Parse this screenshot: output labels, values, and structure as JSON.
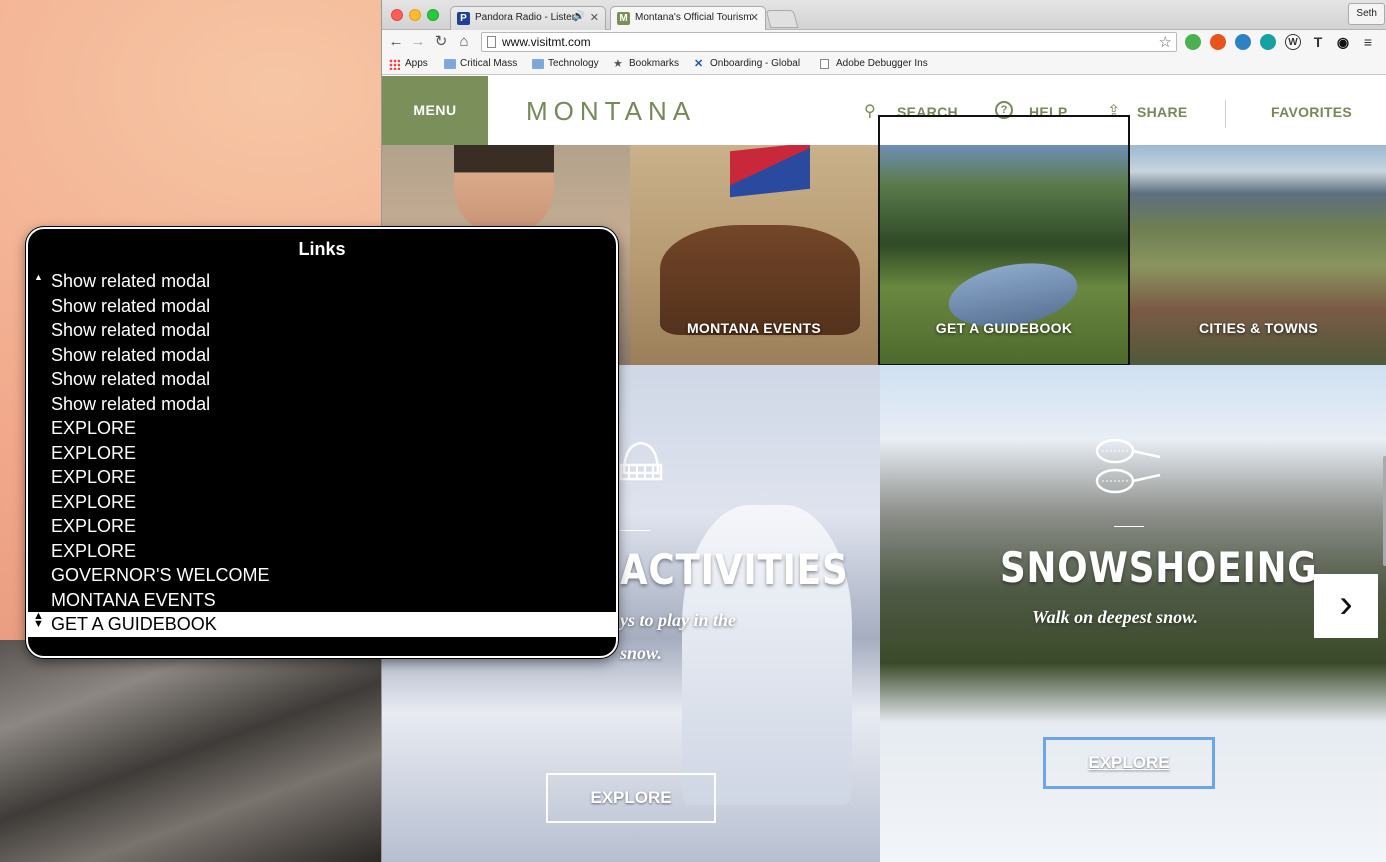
{
  "browser": {
    "tabs": [
      {
        "title": "Pandora Radio - Listen",
        "favicon": "P",
        "favicon_color": "#224099",
        "audio": "🔊"
      },
      {
        "title": "Montana's Official Tourism",
        "favicon": "M",
        "favicon_color": "#7b8f5a"
      }
    ],
    "profile": "Seth",
    "url": "www.visitmt.com",
    "bookmarks": [
      "Apps",
      "Critical Mass",
      "Technology",
      "Bookmarks",
      "Onboarding - Global",
      "Adobe Debugger Ins"
    ]
  },
  "site": {
    "menu_label": "MENU",
    "logo": "MONTANA",
    "nav": {
      "search": "SEARCH",
      "help": "HELP",
      "share": "SHARE",
      "favorites": "FAVORITES"
    },
    "tiles": {
      "events": "MONTANA EVENTS",
      "guidebook": "GET A GUIDEBOOK",
      "cities": "CITIES & TOWNS"
    },
    "winter": {
      "title": "ACTIVITIES",
      "subtitle_line1": "ys to play in the",
      "subtitle_line2": "snow.",
      "button": "EXPLORE"
    },
    "snowshoe": {
      "title": "SNOWSHOEING",
      "subtitle": "Walk on deepest snow.",
      "button": "EXPLORE"
    },
    "next_arrow": "›",
    "accent_color": "#7b8f5a"
  },
  "rotor": {
    "title": "Links",
    "items": [
      "Show related modal",
      "Show related modal",
      "Show related modal",
      "Show related modal",
      "Show related modal",
      "Show related modal",
      "EXPLORE",
      "EXPLORE",
      "EXPLORE",
      "EXPLORE",
      "EXPLORE",
      "EXPLORE",
      "GOVERNOR'S WELCOME",
      "MONTANA EVENTS",
      "GET A GUIDEBOOK"
    ],
    "selected_index": 14
  }
}
